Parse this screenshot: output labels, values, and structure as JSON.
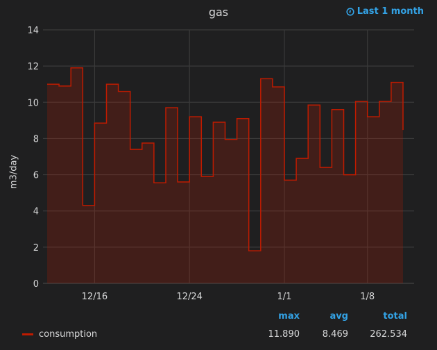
{
  "panel": {
    "title": "gas",
    "time_range": "Last 1 month",
    "time_icon": "clock-icon"
  },
  "legend": {
    "headers": {
      "max": "max",
      "avg": "avg",
      "total": "total"
    },
    "series": [
      {
        "name": "consumption",
        "color": "#bf1b00",
        "max": "11.890",
        "avg": "8.469",
        "total": "262.534"
      }
    ]
  },
  "chart_data": {
    "type": "area",
    "title": "gas",
    "xlabel": "",
    "ylabel": "m3/day",
    "ylim": [
      0,
      14
    ],
    "yticks": [
      "0",
      "2",
      "4",
      "6",
      "8",
      "10",
      "12",
      "14"
    ],
    "xticks": [
      {
        "label": "12/16",
        "day": 4
      },
      {
        "label": "12/24",
        "day": 12
      },
      {
        "label": "1/1",
        "day": 20
      },
      {
        "label": "1/8",
        "day": 27
      }
    ],
    "x_start": "12/12",
    "grid": true,
    "step": true,
    "series": [
      {
        "name": "consumption",
        "color": "#bf1b00",
        "values": [
          11.0,
          10.9,
          11.9,
          4.3,
          8.85,
          11.0,
          10.6,
          7.4,
          7.75,
          5.55,
          9.7,
          5.6,
          9.2,
          5.9,
          8.9,
          7.95,
          9.1,
          1.8,
          11.3,
          10.85,
          5.7,
          6.9,
          9.85,
          6.4,
          9.6,
          6.0,
          10.05,
          9.2,
          10.05,
          11.1,
          8.47
        ]
      }
    ]
  }
}
